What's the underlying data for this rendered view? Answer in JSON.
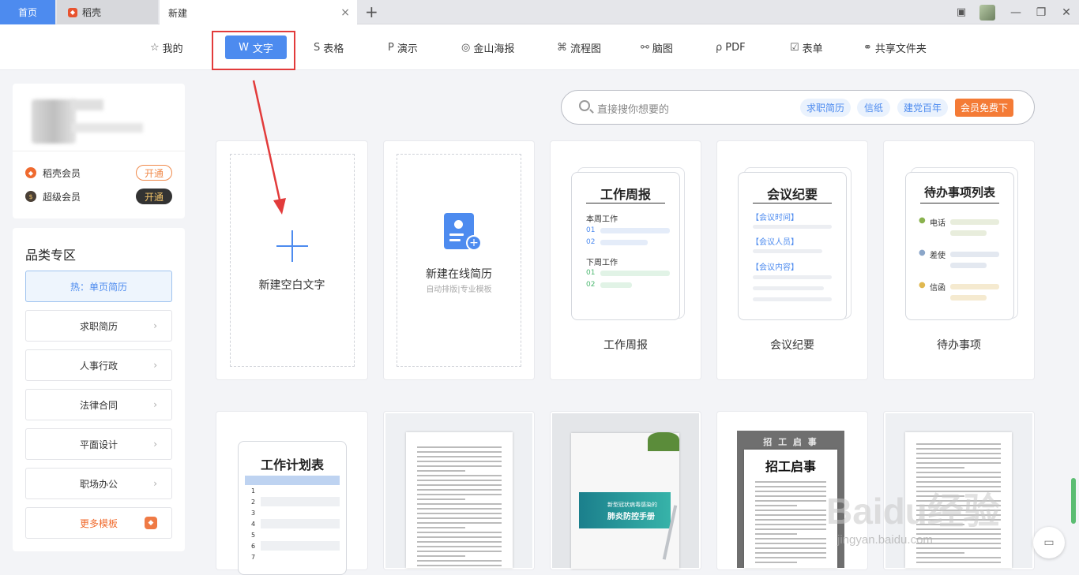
{
  "titlebar": {
    "tabs": [
      {
        "label": "首页"
      },
      {
        "label": "稻壳"
      },
      {
        "label": "新建"
      }
    ],
    "add_tab": "+",
    "close_tab": "×"
  },
  "categories": [
    {
      "label": "我的",
      "icon": "star-icon"
    },
    {
      "label": "文字",
      "icon": "word-icon"
    },
    {
      "label": "表格",
      "icon": "sheet-icon"
    },
    {
      "label": "演示",
      "icon": "presentation-icon"
    },
    {
      "label": "金山海报",
      "icon": "poster-icon"
    },
    {
      "label": "流程图",
      "icon": "flowchart-icon"
    },
    {
      "label": "脑图",
      "icon": "mindmap-icon"
    },
    {
      "label": "PDF",
      "icon": "pdf-icon"
    },
    {
      "label": "表单",
      "icon": "form-icon"
    },
    {
      "label": "共享文件夹",
      "icon": "share-folder-icon"
    }
  ],
  "sidebar": {
    "vip": [
      {
        "label": "稻壳会员",
        "action": "开通"
      },
      {
        "label": "超级会员",
        "action": "开通"
      }
    ],
    "section_title": "品类专区",
    "items": [
      {
        "label": "热：单页简历"
      },
      {
        "label": "求职简历"
      },
      {
        "label": "人事行政"
      },
      {
        "label": "法律合同"
      },
      {
        "label": "平面设计"
      },
      {
        "label": "职场办公"
      },
      {
        "label": "更多模板"
      }
    ]
  },
  "search": {
    "placeholder": "直接搜你想要的",
    "chips": [
      "求职简历",
      "信纸",
      "建党百年"
    ],
    "vip_chip": "会员免费下"
  },
  "templates_row1": [
    {
      "label": "新建空白文字"
    },
    {
      "label": "新建在线简历",
      "sub": "自动排版|专业模板"
    },
    {
      "label": "工作周报",
      "paper_title": "工作周报",
      "sec1": "本周工作",
      "sec2": "下周工作",
      "nums": [
        "01",
        "02",
        "01",
        "02"
      ]
    },
    {
      "label": "会议纪要",
      "paper_title": "会议纪要",
      "items": [
        "【会议时间】",
        "【会议人员】",
        "【会议内容】"
      ]
    },
    {
      "label": "待办事项",
      "paper_title": "待办事项列表",
      "items": [
        "电话",
        "差使",
        "信函"
      ]
    }
  ],
  "templates_row2": [
    {
      "paper_title": "工作计划表",
      "rows": [
        "1",
        "2",
        "3",
        "4",
        "5",
        "6",
        "7"
      ]
    },
    {
      "kind": "document"
    },
    {
      "title_small": "新型冠状病毒感染的",
      "title_big": "肺炎防控手册"
    },
    {
      "banner": "招 工 启 事",
      "title": "招工启事"
    },
    {
      "kind": "document"
    }
  ],
  "watermark": {
    "brand": "Baidu经验",
    "url": "jingyan.baidu.com"
  },
  "colors": {
    "accent": "#4d8bef",
    "highlight_box": "#e23b3b",
    "vip_orange": "#f47b36"
  }
}
